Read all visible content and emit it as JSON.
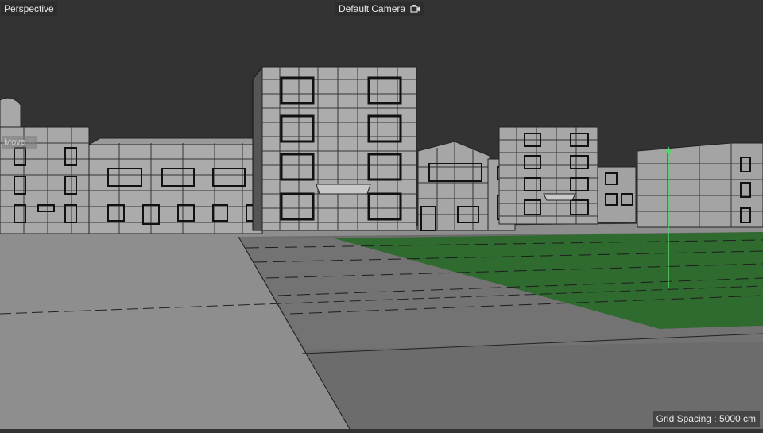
{
  "viewport": {
    "view_mode": "Perspective",
    "camera_name": "Default Camera",
    "camera_icon": "camera-icon",
    "tool_label": "Move",
    "tool_close_icon": "close-icon",
    "grid_spacing": "Grid Spacing : 5000 cm"
  },
  "colors": {
    "background": "#333333",
    "building_face": "#a9a9a9",
    "ground_light": "#8f8f8f",
    "ground_dark": "#6e6e6e",
    "lawn": "#2e6a2e",
    "axis_y": "#56d36a"
  }
}
